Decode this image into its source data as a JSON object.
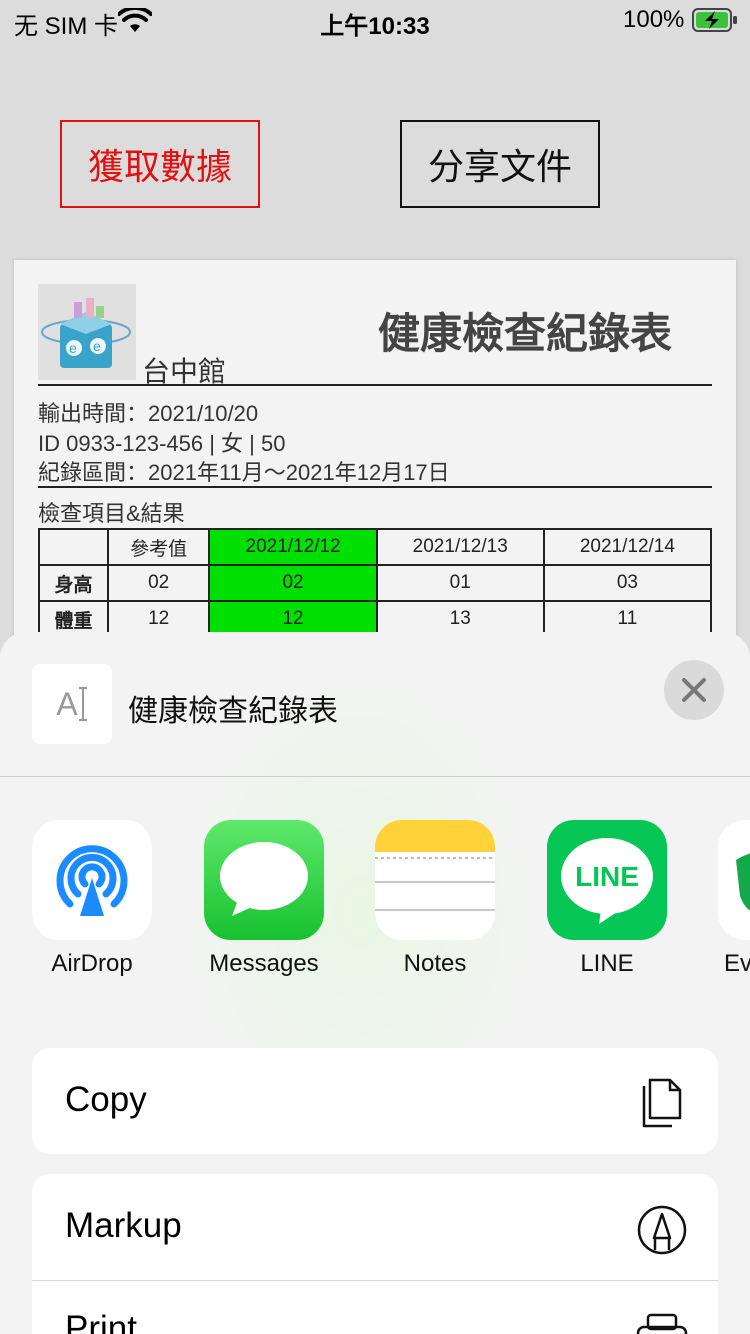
{
  "status_bar": {
    "carrier": "无 SIM 卡",
    "time": "上午10:33",
    "battery_percent": "100%"
  },
  "buttons": {
    "fetch_label": "獲取數據",
    "share_label": "分享文件",
    "fetch_color": "#e21010"
  },
  "document": {
    "branch": "台中館",
    "title": "健康檢查紀錄表",
    "export_time": "輸出時間：2021/10/20",
    "id_line": "ID 0933-123-456 | 女 | 50",
    "record_period": "紀錄區間：2021年11月～2021年12月17日",
    "section_label": "檢查項目&結果",
    "table": {
      "headers": [
        "",
        "參考值",
        "2021/12/12",
        "2021/12/13",
        "2021/12/14"
      ],
      "rows": [
        [
          "身高",
          "02",
          "02",
          "01",
          "03"
        ],
        [
          "體重",
          "12",
          "12",
          "13",
          "11"
        ]
      ],
      "highlight_color": "#00e000"
    }
  },
  "share_sheet": {
    "title": "健康檢查紀錄表",
    "thumb_glyph": "A",
    "apps": [
      {
        "label": "AirDrop",
        "icon": "airdrop-icon"
      },
      {
        "label": "Messages",
        "icon": "messages-icon"
      },
      {
        "label": "Notes",
        "icon": "notes-icon"
      },
      {
        "label": "LINE",
        "icon": "line-icon",
        "icon_text": "LINE"
      },
      {
        "label": "Ev",
        "icon": "evernote-icon"
      }
    ],
    "actions": [
      {
        "label": "Copy",
        "icon": "copy-icon"
      },
      {
        "label": "Markup",
        "icon": "markup-icon"
      },
      {
        "label": "Print",
        "icon": "print-icon"
      }
    ]
  }
}
